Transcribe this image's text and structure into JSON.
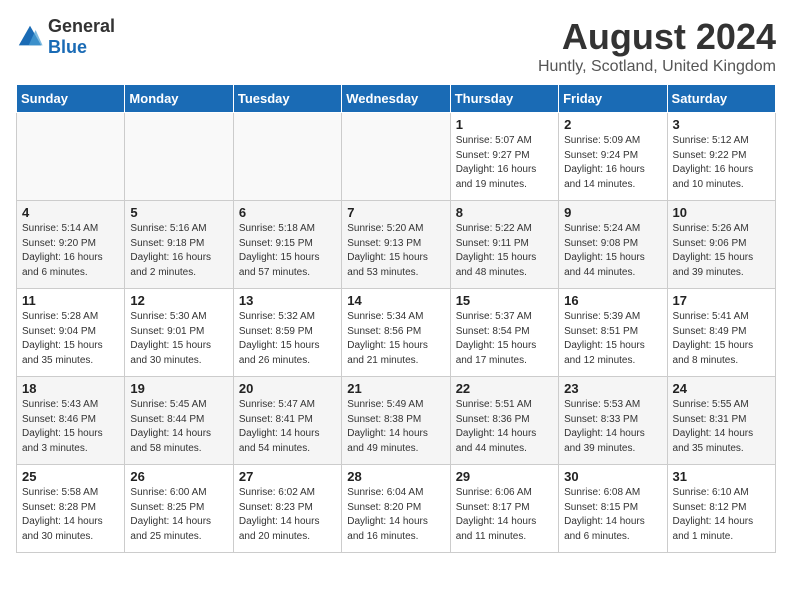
{
  "header": {
    "logo_general": "General",
    "logo_blue": "Blue",
    "month_year": "August 2024",
    "location": "Huntly, Scotland, United Kingdom"
  },
  "days_of_week": [
    "Sunday",
    "Monday",
    "Tuesday",
    "Wednesday",
    "Thursday",
    "Friday",
    "Saturday"
  ],
  "weeks": [
    [
      {
        "day": "",
        "info": ""
      },
      {
        "day": "",
        "info": ""
      },
      {
        "day": "",
        "info": ""
      },
      {
        "day": "",
        "info": ""
      },
      {
        "day": "1",
        "info": "Sunrise: 5:07 AM\nSunset: 9:27 PM\nDaylight: 16 hours and 19 minutes."
      },
      {
        "day": "2",
        "info": "Sunrise: 5:09 AM\nSunset: 9:24 PM\nDaylight: 16 hours and 14 minutes."
      },
      {
        "day": "3",
        "info": "Sunrise: 5:12 AM\nSunset: 9:22 PM\nDaylight: 16 hours and 10 minutes."
      }
    ],
    [
      {
        "day": "4",
        "info": "Sunrise: 5:14 AM\nSunset: 9:20 PM\nDaylight: 16 hours and 6 minutes."
      },
      {
        "day": "5",
        "info": "Sunrise: 5:16 AM\nSunset: 9:18 PM\nDaylight: 16 hours and 2 minutes."
      },
      {
        "day": "6",
        "info": "Sunrise: 5:18 AM\nSunset: 9:15 PM\nDaylight: 15 hours and 57 minutes."
      },
      {
        "day": "7",
        "info": "Sunrise: 5:20 AM\nSunset: 9:13 PM\nDaylight: 15 hours and 53 minutes."
      },
      {
        "day": "8",
        "info": "Sunrise: 5:22 AM\nSunset: 9:11 PM\nDaylight: 15 hours and 48 minutes."
      },
      {
        "day": "9",
        "info": "Sunrise: 5:24 AM\nSunset: 9:08 PM\nDaylight: 15 hours and 44 minutes."
      },
      {
        "day": "10",
        "info": "Sunrise: 5:26 AM\nSunset: 9:06 PM\nDaylight: 15 hours and 39 minutes."
      }
    ],
    [
      {
        "day": "11",
        "info": "Sunrise: 5:28 AM\nSunset: 9:04 PM\nDaylight: 15 hours and 35 minutes."
      },
      {
        "day": "12",
        "info": "Sunrise: 5:30 AM\nSunset: 9:01 PM\nDaylight: 15 hours and 30 minutes."
      },
      {
        "day": "13",
        "info": "Sunrise: 5:32 AM\nSunset: 8:59 PM\nDaylight: 15 hours and 26 minutes."
      },
      {
        "day": "14",
        "info": "Sunrise: 5:34 AM\nSunset: 8:56 PM\nDaylight: 15 hours and 21 minutes."
      },
      {
        "day": "15",
        "info": "Sunrise: 5:37 AM\nSunset: 8:54 PM\nDaylight: 15 hours and 17 minutes."
      },
      {
        "day": "16",
        "info": "Sunrise: 5:39 AM\nSunset: 8:51 PM\nDaylight: 15 hours and 12 minutes."
      },
      {
        "day": "17",
        "info": "Sunrise: 5:41 AM\nSunset: 8:49 PM\nDaylight: 15 hours and 8 minutes."
      }
    ],
    [
      {
        "day": "18",
        "info": "Sunrise: 5:43 AM\nSunset: 8:46 PM\nDaylight: 15 hours and 3 minutes."
      },
      {
        "day": "19",
        "info": "Sunrise: 5:45 AM\nSunset: 8:44 PM\nDaylight: 14 hours and 58 minutes."
      },
      {
        "day": "20",
        "info": "Sunrise: 5:47 AM\nSunset: 8:41 PM\nDaylight: 14 hours and 54 minutes."
      },
      {
        "day": "21",
        "info": "Sunrise: 5:49 AM\nSunset: 8:38 PM\nDaylight: 14 hours and 49 minutes."
      },
      {
        "day": "22",
        "info": "Sunrise: 5:51 AM\nSunset: 8:36 PM\nDaylight: 14 hours and 44 minutes."
      },
      {
        "day": "23",
        "info": "Sunrise: 5:53 AM\nSunset: 8:33 PM\nDaylight: 14 hours and 39 minutes."
      },
      {
        "day": "24",
        "info": "Sunrise: 5:55 AM\nSunset: 8:31 PM\nDaylight: 14 hours and 35 minutes."
      }
    ],
    [
      {
        "day": "25",
        "info": "Sunrise: 5:58 AM\nSunset: 8:28 PM\nDaylight: 14 hours and 30 minutes."
      },
      {
        "day": "26",
        "info": "Sunrise: 6:00 AM\nSunset: 8:25 PM\nDaylight: 14 hours and 25 minutes."
      },
      {
        "day": "27",
        "info": "Sunrise: 6:02 AM\nSunset: 8:23 PM\nDaylight: 14 hours and 20 minutes."
      },
      {
        "day": "28",
        "info": "Sunrise: 6:04 AM\nSunset: 8:20 PM\nDaylight: 14 hours and 16 minutes."
      },
      {
        "day": "29",
        "info": "Sunrise: 6:06 AM\nSunset: 8:17 PM\nDaylight: 14 hours and 11 minutes."
      },
      {
        "day": "30",
        "info": "Sunrise: 6:08 AM\nSunset: 8:15 PM\nDaylight: 14 hours and 6 minutes."
      },
      {
        "day": "31",
        "info": "Sunrise: 6:10 AM\nSunset: 8:12 PM\nDaylight: 14 hours and 1 minute."
      }
    ]
  ]
}
